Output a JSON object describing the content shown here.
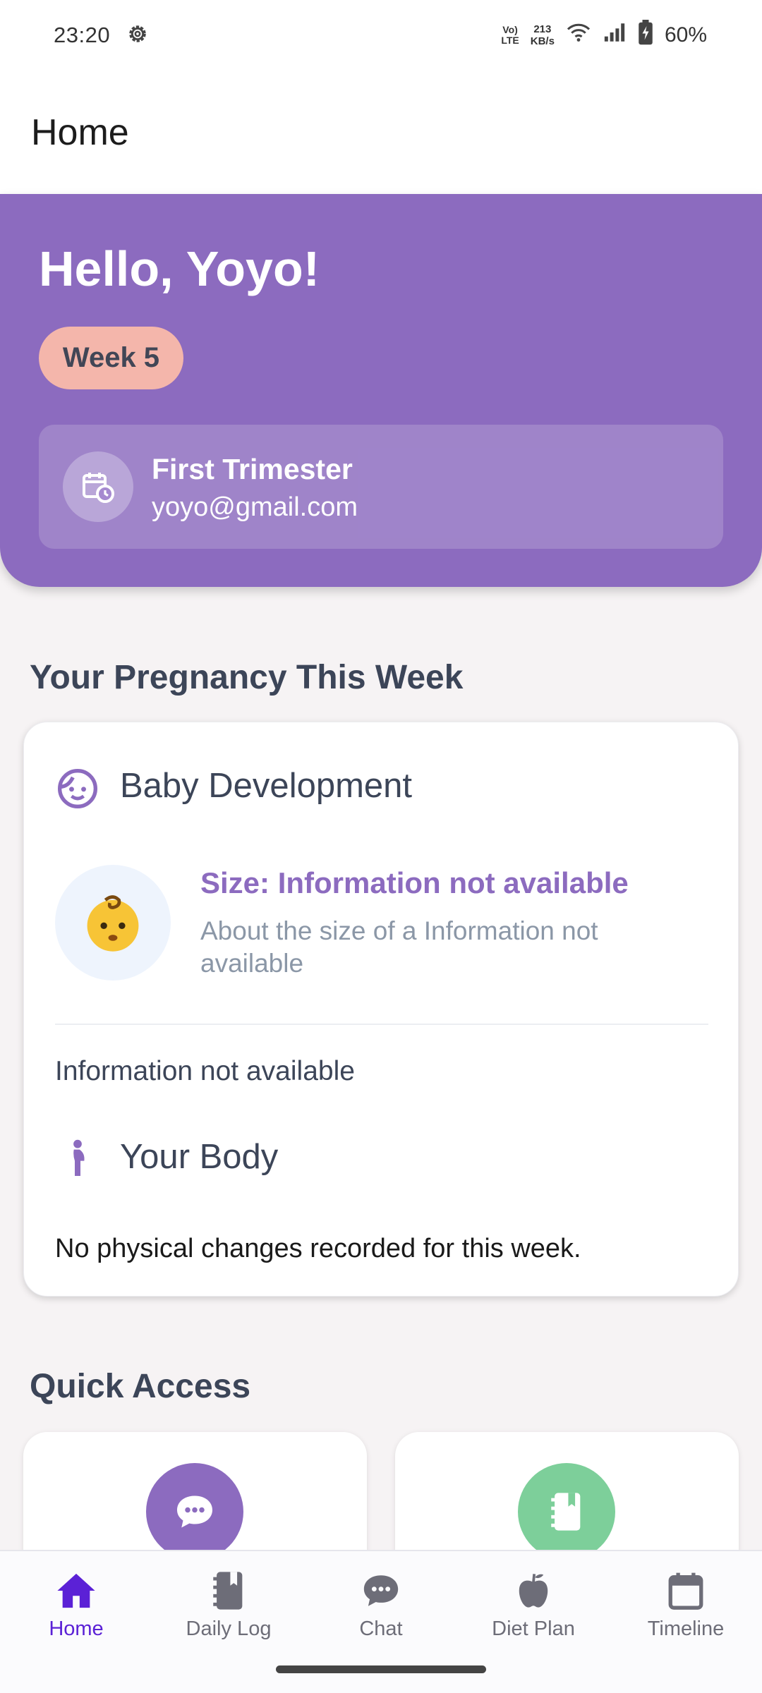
{
  "status_bar": {
    "time": "23:20",
    "volte_top": "Vo)",
    "volte_bottom": "LTE",
    "net_speed_value": "213",
    "net_speed_unit": "KB/s",
    "battery": "60%"
  },
  "app_bar": {
    "title": "Home"
  },
  "hero": {
    "greeting": "Hello, Yoyo!",
    "week_chip": "Week 5",
    "trimester": "First Trimester",
    "email": "yoyo@gmail.com"
  },
  "pregnancy": {
    "section_title": "Your Pregnancy This Week",
    "baby_title": "Baby Development",
    "baby_emoji": "👶",
    "size_title": "Size: Information not available",
    "size_desc": "About the size of a Information not available",
    "info_text": "Information not available",
    "body_title": "Your Body",
    "body_text": "No physical changes recorded for this week."
  },
  "quick_access": {
    "section_title": "Quick Access",
    "tiles": [
      {
        "icon": "chat-bubble-icon",
        "color": "#8c6bbf"
      },
      {
        "icon": "notebook-icon",
        "color": "#7dcf9a"
      }
    ]
  },
  "bottom_nav": {
    "items": [
      {
        "label": "Home",
        "icon": "home-icon",
        "active": true
      },
      {
        "label": "Daily Log",
        "icon": "notebook-icon",
        "active": false
      },
      {
        "label": "Chat",
        "icon": "chat-icon",
        "active": false
      },
      {
        "label": "Diet Plan",
        "icon": "apple-icon",
        "active": false
      },
      {
        "label": "Timeline",
        "icon": "calendar-icon",
        "active": false
      }
    ]
  },
  "colors": {
    "brand_purple": "#8c6bbf",
    "active_nav": "#5b21d6",
    "week_chip": "#f4b6ab",
    "quick_green": "#7dcf9a"
  }
}
